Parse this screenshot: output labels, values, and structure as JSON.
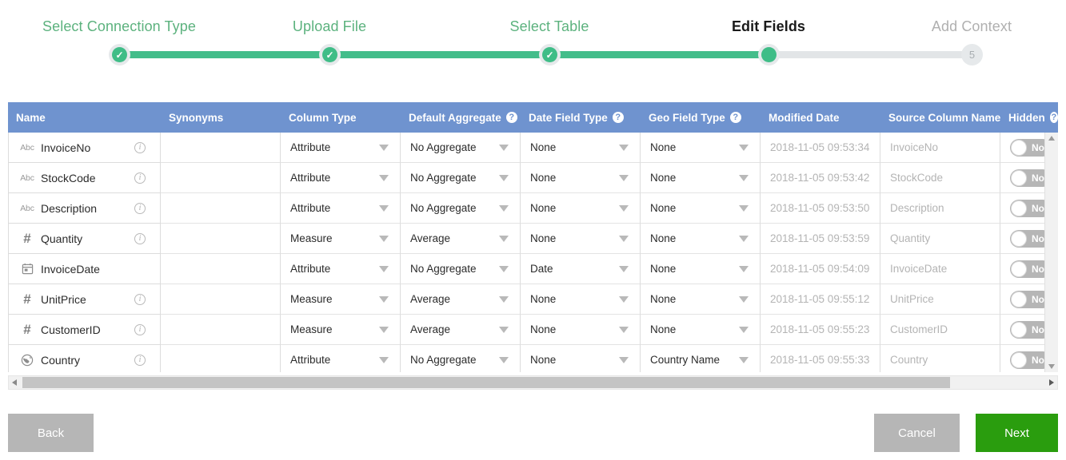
{
  "wizard": {
    "steps": [
      {
        "label": "Select Connection Type",
        "state": "done",
        "marker": "check"
      },
      {
        "label": "Upload File",
        "state": "done",
        "marker": "check"
      },
      {
        "label": "Select Table",
        "state": "done",
        "marker": "check"
      },
      {
        "label": "Edit Fields",
        "state": "active",
        "marker": ""
      },
      {
        "label": "Add Context",
        "state": "todo",
        "marker": "5"
      }
    ],
    "accent_done": "#43bd8a",
    "accent_track": "#e2e5e7",
    "active_text": "#1a1a1a",
    "todo_text": "#b0b0b0"
  },
  "table": {
    "header_bg": "#6f93cf",
    "columns": [
      {
        "label": "Name",
        "help": false
      },
      {
        "label": "Synonyms",
        "help": false
      },
      {
        "label": "Column Type",
        "help": false
      },
      {
        "label": "Default Aggregate",
        "help": true
      },
      {
        "label": "Date Field Type",
        "help": true
      },
      {
        "label": "Geo Field Type",
        "help": true
      },
      {
        "label": "Modified Date",
        "help": false
      },
      {
        "label": "Source Column Name",
        "help": false
      },
      {
        "label": "Hidden",
        "help": true
      }
    ],
    "help_glyph": "?",
    "rows": [
      {
        "icon": "text-abc-icon",
        "icon_glyph": "Abc",
        "name": "InvoiceNo",
        "has_info": true,
        "synonyms": "",
        "column_type": "Attribute",
        "default_aggregate": "No Aggregate",
        "date_field_type": "None",
        "geo_field_type": "None",
        "modified_date": "2018-11-05 09:53:34",
        "source_column_name": "InvoiceNo",
        "hidden": "No"
      },
      {
        "icon": "text-abc-icon",
        "icon_glyph": "Abc",
        "name": "StockCode",
        "has_info": true,
        "synonyms": "",
        "column_type": "Attribute",
        "default_aggregate": "No Aggregate",
        "date_field_type": "None",
        "geo_field_type": "None",
        "modified_date": "2018-11-05 09:53:42",
        "source_column_name": "StockCode",
        "hidden": "No"
      },
      {
        "icon": "text-abc-icon",
        "icon_glyph": "Abc",
        "name": "Description",
        "has_info": true,
        "synonyms": "",
        "column_type": "Attribute",
        "default_aggregate": "No Aggregate",
        "date_field_type": "None",
        "geo_field_type": "None",
        "modified_date": "2018-11-05 09:53:50",
        "source_column_name": "Description",
        "hidden": "No"
      },
      {
        "icon": "number-hash-icon",
        "icon_glyph": "#",
        "name": "Quantity",
        "has_info": true,
        "synonyms": "",
        "column_type": "Measure",
        "default_aggregate": "Average",
        "date_field_type": "None",
        "geo_field_type": "None",
        "modified_date": "2018-11-05 09:53:59",
        "source_column_name": "Quantity",
        "hidden": "No"
      },
      {
        "icon": "calendar-icon",
        "icon_glyph": "",
        "name": "InvoiceDate",
        "has_info": false,
        "synonyms": "",
        "column_type": "Attribute",
        "default_aggregate": "No Aggregate",
        "date_field_type": "Date",
        "geo_field_type": "None",
        "modified_date": "2018-11-05 09:54:09",
        "source_column_name": "InvoiceDate",
        "hidden": "No"
      },
      {
        "icon": "number-hash-icon",
        "icon_glyph": "#",
        "name": "UnitPrice",
        "has_info": true,
        "synonyms": "",
        "column_type": "Measure",
        "default_aggregate": "Average",
        "date_field_type": "None",
        "geo_field_type": "None",
        "modified_date": "2018-11-05 09:55:12",
        "source_column_name": "UnitPrice",
        "hidden": "No"
      },
      {
        "icon": "number-hash-icon",
        "icon_glyph": "#",
        "name": "CustomerID",
        "has_info": true,
        "synonyms": "",
        "column_type": "Measure",
        "default_aggregate": "Average",
        "date_field_type": "None",
        "geo_field_type": "None",
        "modified_date": "2018-11-05 09:55:23",
        "source_column_name": "CustomerID",
        "hidden": "No"
      },
      {
        "icon": "globe-icon",
        "icon_glyph": "",
        "name": "Country",
        "has_info": true,
        "synonyms": "",
        "column_type": "Attribute",
        "default_aggregate": "No Aggregate",
        "date_field_type": "None",
        "geo_field_type": "Country Name",
        "modified_date": "2018-11-05 09:55:33",
        "source_column_name": "Country",
        "hidden": "No"
      }
    ]
  },
  "footer": {
    "back_label": "Back",
    "cancel_label": "Cancel",
    "next_label": "Next",
    "next_color": "#2a9d0e",
    "muted_color": "#b6b6b6"
  }
}
